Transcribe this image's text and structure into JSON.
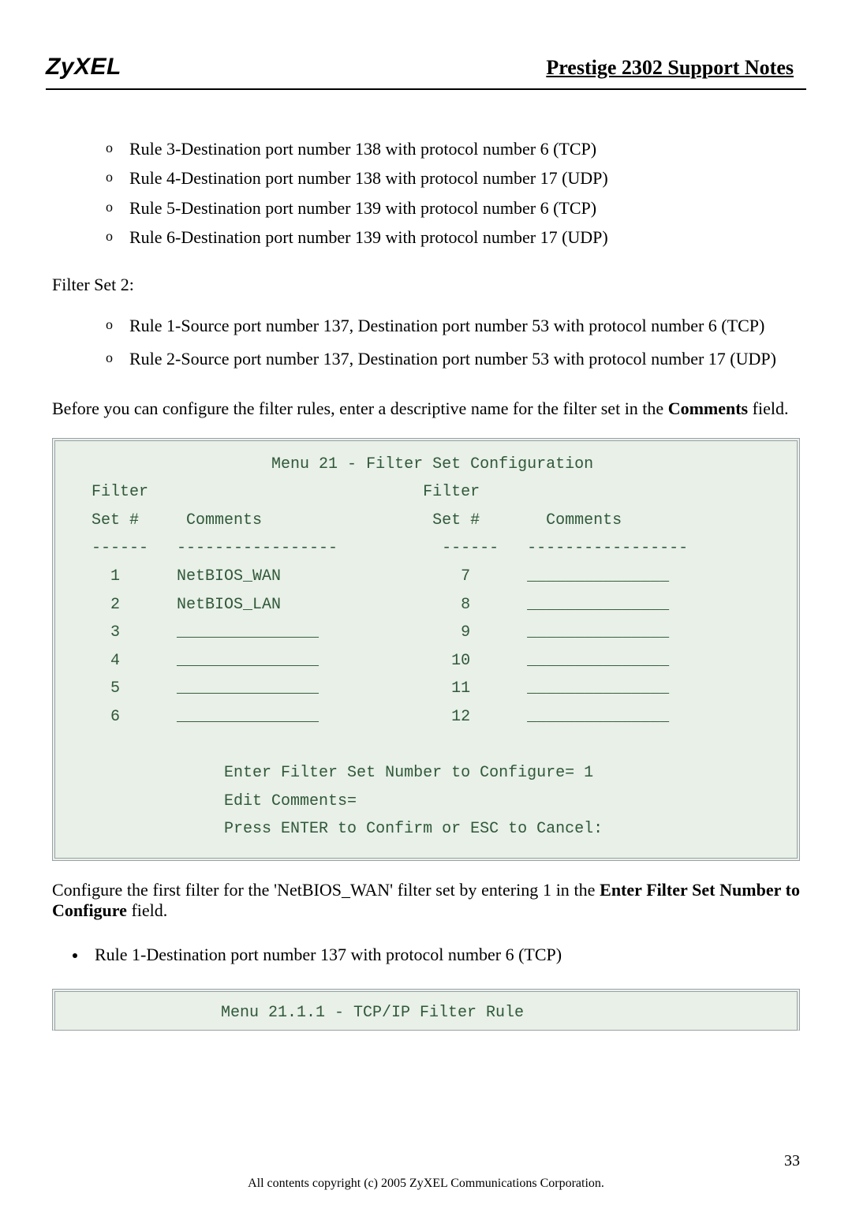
{
  "header": {
    "logo": "ZyXEL",
    "title": "Prestige 2302 Support Notes"
  },
  "rules_set1": [
    "Rule 3-Destination port number 138 with protocol number 6 (TCP)",
    "Rule 4-Destination port number 138 with protocol number 17 (UDP)",
    "Rule 5-Destination port number 139 with protocol number 6 (TCP)",
    "Rule 6-Destination port number 139 with protocol number 17 (UDP)"
  ],
  "filter_set2_label": "Filter Set 2:",
  "rules_set2": [
    "Rule 1-Source port number 137, Destination port number 53 with protocol number 6 (TCP)",
    "Rule 2-Source port number 137, Destination port number 53 with protocol number 17 (UDP)"
  ],
  "pre_terminal_text": {
    "before": "Before you can configure the filter rules, enter a descriptive name for the filter set in the ",
    "bold": "Comments",
    "after": " field."
  },
  "terminal1": "                      Menu 21 - Filter Set Configuration\n   Filter                             Filter\n   Set #     Comments                  Set #       Comments\n   ------   -----------------           ------   -----------------\n     1      NetBIOS_WAN                   7      _______________\n     2      NetBIOS_LAN                   8      _______________\n     3      _______________               9      _______________\n     4      _______________              10      _______________\n     5      _______________              11      _______________\n     6      _______________              12      _______________\n\n                 Enter Filter Set Number to Configure= 1\n                 Edit Comments=\n                 Press ENTER to Confirm or ESC to Cancel:",
  "post_terminal": {
    "before": "Configure the first filter for the 'NetBIOS_WAN' filter set by entering 1 in the ",
    "bold": "Enter Filter Set Number to Configure",
    "after": " field."
  },
  "rule_bullet": "Rule 1-Destination port number 137 with protocol number 6 (TCP)",
  "terminal2": "Menu 21.1.1 - TCP/IP Filter Rule",
  "page_number": "33",
  "footer": "All contents copyright (c) 2005 ZyXEL Communications Corporation."
}
